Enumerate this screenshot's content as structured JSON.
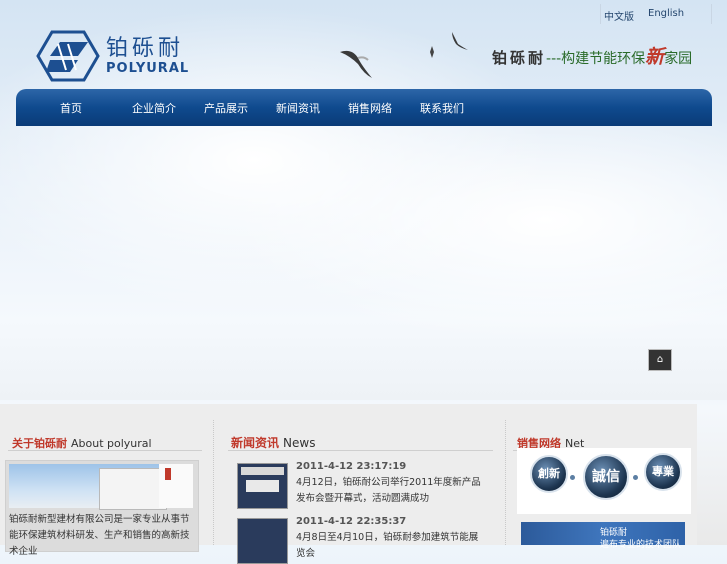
{
  "header": {
    "languages": [
      "中文版",
      "English"
    ],
    "logo": {
      "cn": "铂砾耐",
      "en": "POLYURAL"
    },
    "slogan": {
      "brand": "铂砾耐",
      "prefix": "---构建节能环保",
      "highlight": "新",
      "suffix": "家园"
    }
  },
  "nav": {
    "items": [
      "首页",
      "企业简介",
      "产品展示",
      "新闻资讯",
      "销售网络",
      "联系我们"
    ]
  },
  "banner": {
    "control_icon": "speech-bubble-icon",
    "control_label": "⌂"
  },
  "about": {
    "title_cn": "关于铂砾耐",
    "title_en": "About polyural",
    "text": "铂砾耐新型建材有限公司是一家专业从事节能环保建筑材料研发、生产和销售的高新技术企业"
  },
  "news": {
    "title_cn": "新闻资讯",
    "title_en": "News",
    "items": [
      {
        "date": "2011-4-12 23:17:19",
        "text": "4月12日，铂砾耐公司举行2011年度新产品发布会暨开幕式，活动圆满成功"
      },
      {
        "date": "2011-4-12 22:35:37",
        "text": "4月8日至4月10日，铂砾耐参加建筑节能展览会"
      }
    ]
  },
  "sales": {
    "title_cn": "销售网络",
    "title_en": "Net",
    "badges": [
      "創新",
      "誠信",
      "專業"
    ],
    "map_text": [
      "铂砾耐",
      "遍布专业的技术团队"
    ]
  }
}
